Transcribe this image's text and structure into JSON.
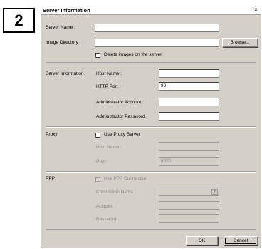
{
  "step_number": "2",
  "dialog": {
    "title": "Server Information",
    "close_glyph": "×"
  },
  "top": {
    "server_name_label": "Server Name :",
    "server_name_value": "",
    "image_directory_label": "Image Directory :",
    "image_directory_value": "",
    "browse_label": "Browse...",
    "delete_images_label": "Delete images on the server"
  },
  "server_information": {
    "section_label": "Server Information",
    "host_name_label": "Host Name :",
    "host_name_value": "",
    "http_port_label": "HTTP Port :",
    "http_port_value": "80",
    "admin_account_label": "Administrator Account :",
    "admin_account_value": "",
    "admin_password_label": "Administrator Password :",
    "admin_password_value": ""
  },
  "proxy": {
    "section_label": "Proxy",
    "use_proxy_label": "Use Proxy Server",
    "host_name_label": "Host Name :",
    "host_name_value": "",
    "port_label": "Port :",
    "port_value": "8080"
  },
  "ppp": {
    "section_label": "PPP",
    "use_ppp_label": "Use PPP Connection",
    "connection_name_label": "Connection Name :",
    "connection_name_value": "",
    "account_label": "Account :",
    "account_value": "",
    "password_label": "Password :",
    "password_value": ""
  },
  "footer": {
    "ok_label": "OK",
    "cancel_label": "Cancel"
  },
  "icons": {
    "dropdown_arrow": "▼"
  }
}
